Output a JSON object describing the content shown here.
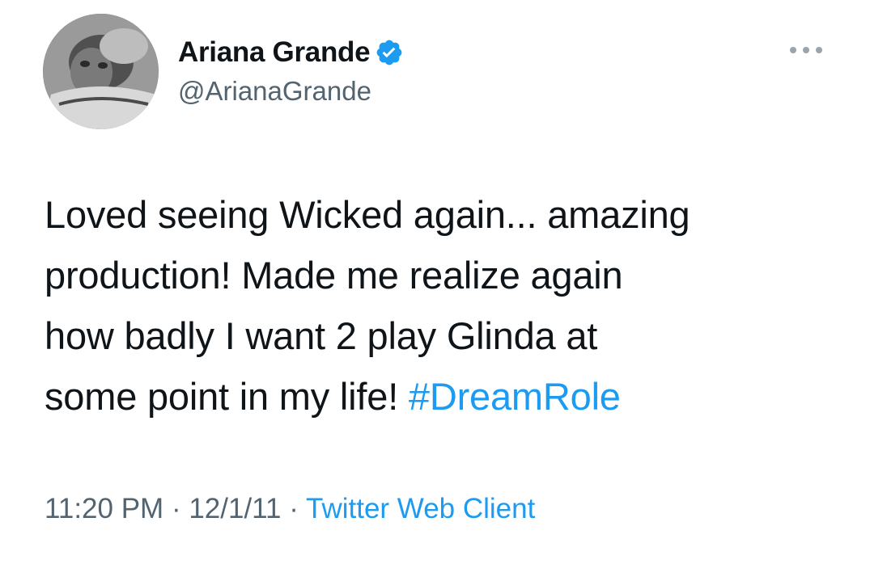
{
  "user": {
    "display_name": "Ariana Grande",
    "handle": "@ArianaGrande",
    "verified": true
  },
  "tweet": {
    "lines": [
      "Loved seeing Wicked again... amazing",
      "production! Made me realize again",
      "how badly I want 2 play Glinda at",
      "some point in my life! "
    ],
    "hashtag": "#DreamRole"
  },
  "meta": {
    "time": "11:20 PM",
    "separator": " · ",
    "date": "12/1/11",
    "source": "Twitter Web Client"
  },
  "colors": {
    "link": "#1d9bf0",
    "secondary": "#536471",
    "text": "#0f1419"
  },
  "icons": {
    "verified": "verified-badge-icon",
    "more": "more-options-icon"
  }
}
